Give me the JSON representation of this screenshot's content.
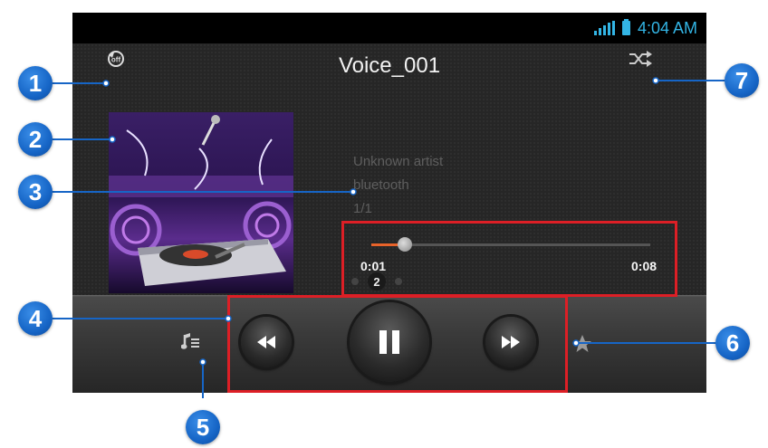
{
  "status": {
    "time": "4:04 AM"
  },
  "player": {
    "title": "Voice_001",
    "artist": "Unknown artist",
    "album": "bluetooth",
    "track_count": "1/1",
    "current_time": "0:01",
    "total_time": "0:08",
    "progress": 0.12,
    "page_indicator": "2"
  },
  "icons": {
    "repeat": "repeat-off-icon",
    "shuffle": "shuffle-icon",
    "playlist": "playlist-icon",
    "favorite": "star-icon",
    "prev": "rewind-icon",
    "play_pause": "pause-icon",
    "next": "fast-forward-icon"
  },
  "callouts": [
    "1",
    "2",
    "3",
    "4",
    "5",
    "6",
    "7"
  ],
  "colors": {
    "accent": "#33b5e5",
    "progress": "#e8632a",
    "highlight": "#dd1f26",
    "callout": "#1665c6"
  }
}
